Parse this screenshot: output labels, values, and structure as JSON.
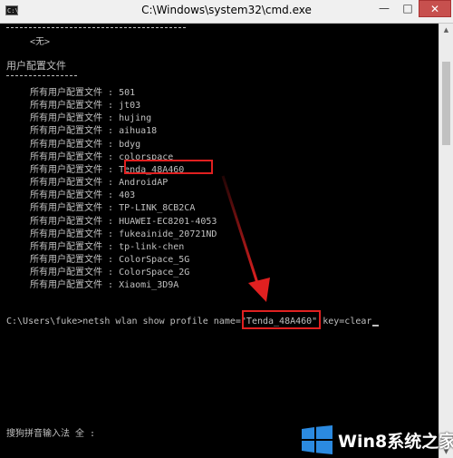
{
  "window": {
    "title": "C:\\Windows\\system32\\cmd.exe",
    "icon_label": "C:\\",
    "minimize_glyph": "—",
    "maximize_glyph": "□",
    "close_glyph": "✕"
  },
  "console": {
    "none_label": "<无>",
    "section_title": "用户配置文件",
    "profile_prefix": "所有用户配置文件 : ",
    "profiles": [
      "501",
      "jt03",
      "hujing",
      "aihua18",
      "bdyg",
      "colorspace",
      "Tenda_48A460",
      "AndroidAP",
      "403",
      "TP-LINK_8CB2CA",
      "HUAWEI-EC8201-4053",
      "fukeainide_20721ND",
      "tp-link-chen",
      "ColorSpace_5G",
      "ColorSpace_2G",
      "Xiaomi_3D9A"
    ],
    "prompt": "C:\\Users\\fuke>",
    "command_before": "netsh wlan show profile name=",
    "command_highlight": "\"Tenda_48A460\"",
    "command_after": " key=clear",
    "ime_status": "搜狗拼音输入法 全 :"
  },
  "watermark": {
    "text": "Win8系统之家"
  },
  "colors": {
    "console_text": "#c0c0c0",
    "console_bg": "#000000",
    "highlight": "#e02020",
    "close_button": "#c7504e"
  },
  "icons": [
    "cmd-app-icon",
    "minimize-icon",
    "maximize-icon",
    "close-icon",
    "scroll-up-icon",
    "scroll-down-icon",
    "windows-logo-icon"
  ]
}
